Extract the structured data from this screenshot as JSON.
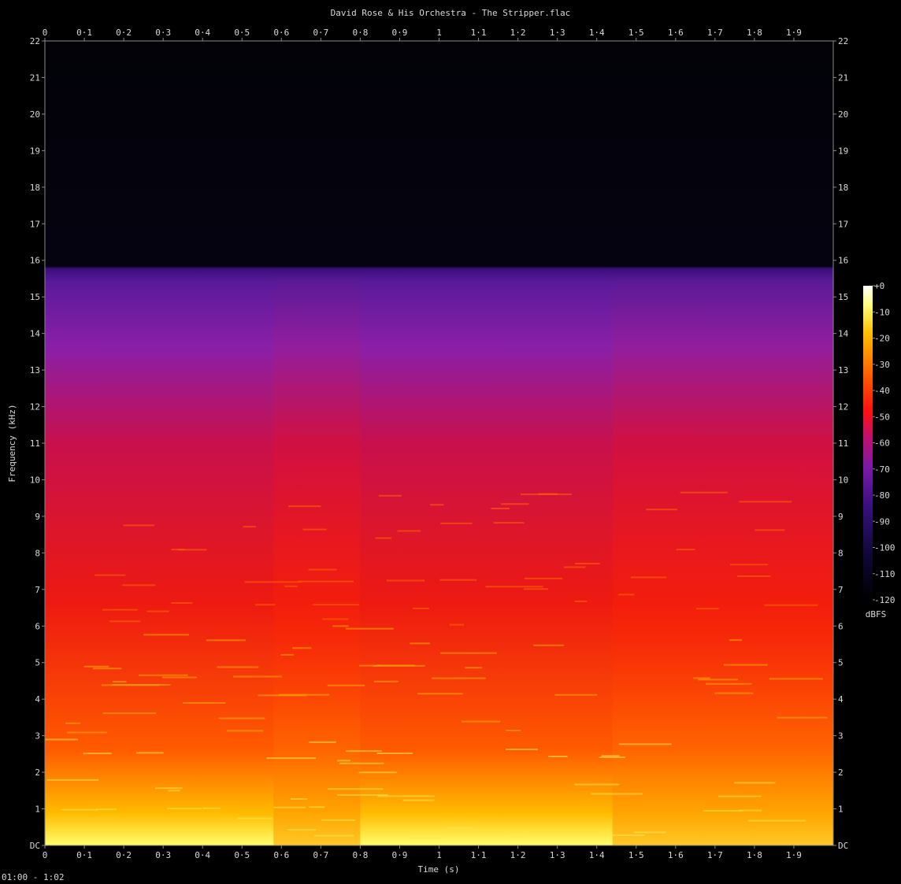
{
  "title": "David Rose & His Orchestra - The Stripper.flac",
  "footer": "01:00 - 1:02",
  "chart_data": {
    "type": "heatmap",
    "title": "David Rose & His Orchestra - The Stripper.flac",
    "xlabel": "Time (s)",
    "ylabel": "Frequency (kHz)",
    "xlim": [
      0,
      2.0
    ],
    "ylim": [
      0,
      22
    ],
    "x_ticks": [
      "0",
      "0·1",
      "0·2",
      "0·3",
      "0·4",
      "0·5",
      "0·6",
      "0·7",
      "0·8",
      "0·9",
      "1",
      "1·1",
      "1·2",
      "1·3",
      "1·4",
      "1·5",
      "1·6",
      "1·7",
      "1·8",
      "1·9"
    ],
    "y_ticks": [
      "DC",
      "1",
      "2",
      "3",
      "4",
      "5",
      "6",
      "7",
      "8",
      "9",
      "10",
      "11",
      "12",
      "13",
      "14",
      "15",
      "16",
      "17",
      "18",
      "19",
      "20",
      "21",
      "22"
    ],
    "colorbar": {
      "label": "dBFS",
      "min": -120,
      "max": 0,
      "ticks": [
        "+0",
        "-10",
        "-20",
        "-30",
        "-40",
        "-50",
        "-60",
        "-70",
        "-80",
        "-90",
        "-100",
        "-110",
        "-120"
      ],
      "colors": [
        "#000000",
        "#1a0a4a",
        "#4a148c",
        "#8a1fa8",
        "#c8106c",
        "#ff1010",
        "#ff6000",
        "#ffc000",
        "#ffff80",
        "#ffffff"
      ]
    },
    "cutoff_khz": 15.8,
    "events": [
      {
        "t_start": 0.58,
        "t_end": 0.8,
        "description_level": "high"
      },
      {
        "t_start": 1.44,
        "t_end": 2.0,
        "description_level": "high"
      }
    ]
  }
}
